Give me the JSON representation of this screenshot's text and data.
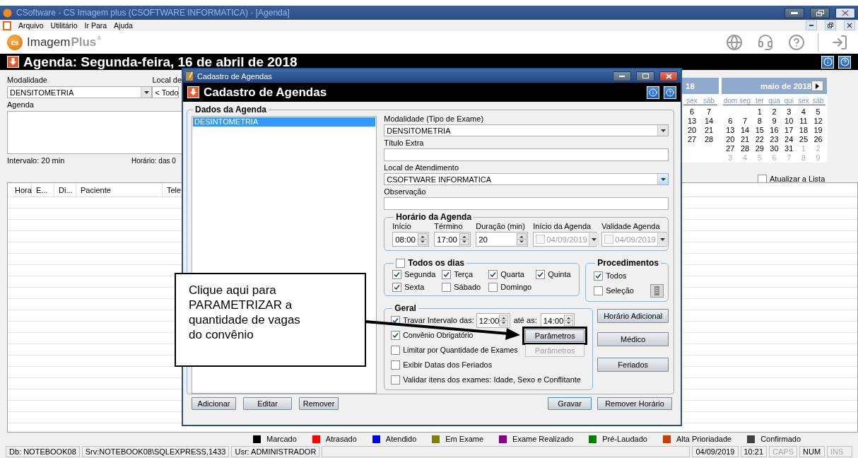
{
  "window": {
    "title": "CSoftware - CS Imagem plus (CSOFTWARE INFORMATICA) - [Agenda]"
  },
  "menu": [
    "Arquivo",
    "Utilitário",
    "Ir Para",
    "Ajuda"
  ],
  "brand": {
    "badge": "cs",
    "name": "Imagem",
    "suffix": "Plus",
    "mark": "®"
  },
  "page_header": {
    "title": "Agenda: Segunda-feira, 16 de abril de 2018"
  },
  "filters": {
    "modality_label": "Modalidade",
    "modality_value": "DENSITOMETRIA",
    "place_label": "Local de",
    "place_value": "< Todo",
    "agenda_label": "Agenda",
    "interval": "Intervalo: 20 min",
    "hours": "Horário: das 0"
  },
  "calendars": [
    {
      "month": "18",
      "weekdays": [
        "sex",
        "sáb"
      ],
      "weeks": [
        [
          "6",
          "7"
        ],
        [
          "13",
          "14"
        ],
        [
          "20",
          "21"
        ],
        [
          "27",
          "28"
        ]
      ]
    },
    {
      "month": "maio de 2018",
      "weekdays": [
        "dom",
        "seg",
        "ter",
        "qua",
        "qui",
        "sex",
        "sáb"
      ],
      "weeks": [
        [
          "1",
          "2",
          "3",
          "4",
          "5"
        ],
        [
          "6",
          "7",
          "8",
          "9",
          "10",
          "11",
          "12"
        ],
        [
          "13",
          "14",
          "15",
          "16",
          "17",
          "18",
          "19"
        ],
        [
          "20",
          "21",
          "22",
          "23",
          "24",
          "25",
          "26"
        ],
        [
          "27",
          "28",
          "29",
          "30",
          "31"
        ]
      ],
      "next_month_days": [
        "1",
        "2",
        "3",
        "4",
        "5",
        "6",
        "7",
        "8",
        "9"
      ]
    }
  ],
  "refresh": {
    "label": "Atualizar a Lista",
    "checked": false
  },
  "table": {
    "columns": [
      "Hora",
      "E...",
      "Di...",
      "Paciente",
      "Tele"
    ]
  },
  "legend": [
    {
      "label": "Marcado",
      "color": "#000000"
    },
    {
      "label": "Atrasado",
      "color": "#ff0000"
    },
    {
      "label": "Atendido",
      "color": "#0000ff"
    },
    {
      "label": "Em Exame",
      "color": "#808000"
    },
    {
      "label": "Exame Realizado",
      "color": "#800080"
    },
    {
      "label": "Pré-Laudado",
      "color": "#008000"
    },
    {
      "label": "Alta Prioriadade",
      "color": "#c04000"
    },
    {
      "label": "Confirmado",
      "color": "#404040"
    }
  ],
  "status_bar": [
    {
      "text": "Db: NOTEBOOK08",
      "on": true
    },
    {
      "text": "Srv:NOTEBOOK08\\SQLEXPRESS,1433",
      "on": true
    },
    {
      "text": "Usr: ADMINISTRADOR",
      "on": true
    },
    {
      "text": "04/09/2019",
      "on": true
    },
    {
      "text": "10:21",
      "on": true
    },
    {
      "text": "CAPS",
      "on": false
    },
    {
      "text": "NUM",
      "on": true
    },
    {
      "text": "INS",
      "on": false
    }
  ],
  "dialog": {
    "title": "Cadastro de Agendas",
    "header": "Cadastro de Agendas",
    "group_title": "Dados da Agenda",
    "list": [
      {
        "label": "DESINTOMETRIA",
        "selected": true
      }
    ],
    "fields": [
      {
        "label": "Modalidade (Tipo de Exame)",
        "value": "DENSITOMETRIA",
        "kind": "select"
      },
      {
        "label": "Título Extra",
        "kind": "text"
      },
      {
        "label": "Local de Atendimento",
        "value": "CSOFTWARE INFORMATICA",
        "kind": "select"
      },
      {
        "label": "Observação",
        "kind": "text"
      }
    ],
    "schedule": {
      "title": "Horário da Agenda",
      "items": [
        {
          "kind": "spin",
          "label": "Início",
          "value": "08:00"
        },
        {
          "kind": "spin",
          "label": "Término",
          "value": "17:00"
        },
        {
          "kind": "spin",
          "label": "Duração (min)",
          "value": "20"
        },
        {
          "kind": "date",
          "label": "Início da Agenda",
          "value": "04/09/2019",
          "checked": false,
          "disabled": true
        },
        {
          "kind": "date",
          "label": "Validade Agenda",
          "value": "04/09/2019",
          "checked": false,
          "disabled": true
        }
      ]
    },
    "days": {
      "title": "Todos os dias",
      "checked": false,
      "items": [
        {
          "label": "Segunda",
          "checked": true
        },
        {
          "label": "Terça",
          "checked": true
        },
        {
          "label": "Quarta",
          "checked": true
        },
        {
          "label": "Quinta",
          "checked": true
        },
        {
          "label": "Sexta",
          "checked": true
        },
        {
          "label": "Sábado",
          "checked": false
        },
        {
          "label": "Domingo",
          "checked": false
        }
      ]
    },
    "procedures": {
      "title": "Procedimentos",
      "items": [
        {
          "label": "Todos",
          "checked": true
        },
        {
          "label": "Seleção",
          "checked": false
        }
      ]
    },
    "general": {
      "title": "Geral",
      "rows": [
        {
          "kind": "interval",
          "label": "Travar Intervalo das:",
          "checked": true,
          "from": "12:00",
          "to_label": "até as:",
          "to": "14:00"
        },
        {
          "kind": "button",
          "label": "Convênio Obrigatório",
          "checked": true,
          "button": "Parâmetros",
          "disabled": false,
          "highlighted": true
        },
        {
          "kind": "button",
          "label": "Limitar por Quantidade de Exames",
          "checked": false,
          "button": "Parâmetros",
          "disabled": true,
          "highlighted": false
        },
        {
          "kind": "check",
          "label": "Exibir Datas dos Feriados",
          "checked": false
        },
        {
          "kind": "check",
          "label": "Validar itens dos exames: Idade, Sexo e Conflitante",
          "checked": false
        }
      ]
    },
    "side_buttons": [
      "Horário Adicional",
      "Médico",
      "Feriados"
    ],
    "list_buttons": [
      "Adicionar",
      "Editar",
      "Remover"
    ],
    "footer_buttons": [
      "Gravar",
      "Remover Horário"
    ]
  },
  "callout": {
    "text": "Clique aqui para\nPARAMETRIZAR a\nquantidade de vagas\ndo convênio"
  }
}
